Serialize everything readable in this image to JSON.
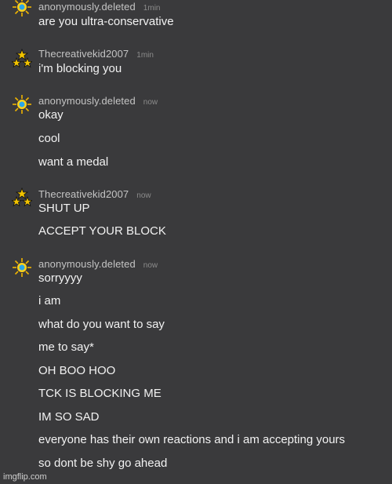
{
  "colors": {
    "background": "#3a3a3c",
    "username": "#c4c4c4",
    "timestamp": "#8c8c8c",
    "message": "#f2f2f2"
  },
  "groups": [
    {
      "user": "anonymously.deleted",
      "time": "1min",
      "avatar": "sun-icon",
      "lines": [
        "are you ultra-conservative"
      ]
    },
    {
      "user": "Thecreativekid2007",
      "time": "1min",
      "avatar": "stars-triangle-icon",
      "lines": [
        "i'm blocking you"
      ]
    },
    {
      "user": "anonymously.deleted",
      "time": "now",
      "avatar": "sun-icon",
      "lines": [
        "okay",
        "cool",
        "want a medal"
      ]
    },
    {
      "user": "Thecreativekid2007",
      "time": "now",
      "avatar": "stars-triangle-icon",
      "lines": [
        "SHUT UP",
        "ACCEPT YOUR BLOCK"
      ]
    },
    {
      "user": "anonymously.deleted",
      "time": "now",
      "avatar": "sun-icon",
      "lines": [
        "sorryyyy",
        "i am",
        "what do you want to say",
        "me to say*",
        "OH BOO HOO",
        "TCK IS BLOCKING ME",
        "IM SO SAD",
        "everyone has their own reactions and i am accepting yours",
        "so dont be shy go ahead"
      ]
    }
  ],
  "watermark": "imgflip.com"
}
